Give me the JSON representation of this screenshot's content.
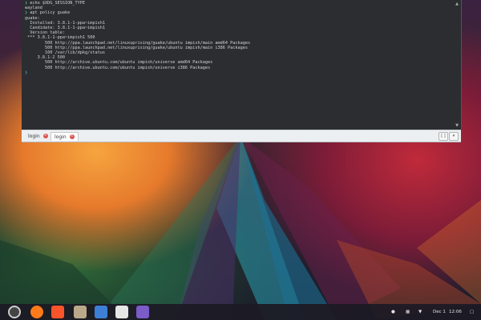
{
  "terminal": {
    "lines": [
      {
        "prompt": "❯",
        "text": " echo $XDG_SESSION_TYPE"
      },
      {
        "prompt": "",
        "text": "wayland"
      },
      {
        "prompt": "❯",
        "text": " apt policy guake"
      },
      {
        "prompt": "",
        "text": "guake:"
      },
      {
        "prompt": "",
        "text": "  Installed: 3.8.1-1-ppa~impish1"
      },
      {
        "prompt": "",
        "text": "  Candidate: 3.8.1-1-ppa~impish1"
      },
      {
        "prompt": "",
        "text": "  Version table:"
      },
      {
        "prompt": "",
        "text": " *** 3.8.1-1-ppa~impish1 500"
      },
      {
        "prompt": "",
        "text": "        500 http://ppa.launchpad.net/linuxuprising/guake/ubuntu impish/main amd64 Packages"
      },
      {
        "prompt": "",
        "text": "        500 http://ppa.launchpad.net/linuxuprising/guake/ubuntu impish/main i386 Packages"
      },
      {
        "prompt": "",
        "text": "        100 /var/lib/dpkg/status"
      },
      {
        "prompt": "",
        "text": "     3.8.1-2 500"
      },
      {
        "prompt": "",
        "text": "        500 http://archive.ubuntu.com/ubuntu impish/universe amd64 Packages"
      },
      {
        "prompt": "",
        "text": "        500 http://archive.ubuntu.com/ubuntu impish/universe i386 Packages"
      },
      {
        "prompt": "❯",
        "text": " "
      }
    ],
    "scroll_up_icon": "▲",
    "scroll_down_icon": "▼"
  },
  "tabs": [
    {
      "label": "login",
      "close": "×"
    },
    {
      "label": "login",
      "close": "×"
    }
  ],
  "tabbar_buttons": {
    "search": "[ ]",
    "dropdown": "▾"
  },
  "taskbar": {
    "apps": [
      {
        "name": "launcher-icon",
        "color": "#d8d8d8"
      },
      {
        "name": "firefox-icon",
        "color": "#ff7a1a"
      },
      {
        "name": "brave-icon",
        "color": "#fb542b"
      },
      {
        "name": "files-icon",
        "color": "#b9a98a"
      },
      {
        "name": "text-editor-icon",
        "color": "#3d7fd6"
      },
      {
        "name": "image-viewer-icon",
        "color": "#e6e6e6"
      },
      {
        "name": "app-icon",
        "color": "#7b5cc9"
      }
    ],
    "date": "Dec 1",
    "time": "12:06"
  }
}
